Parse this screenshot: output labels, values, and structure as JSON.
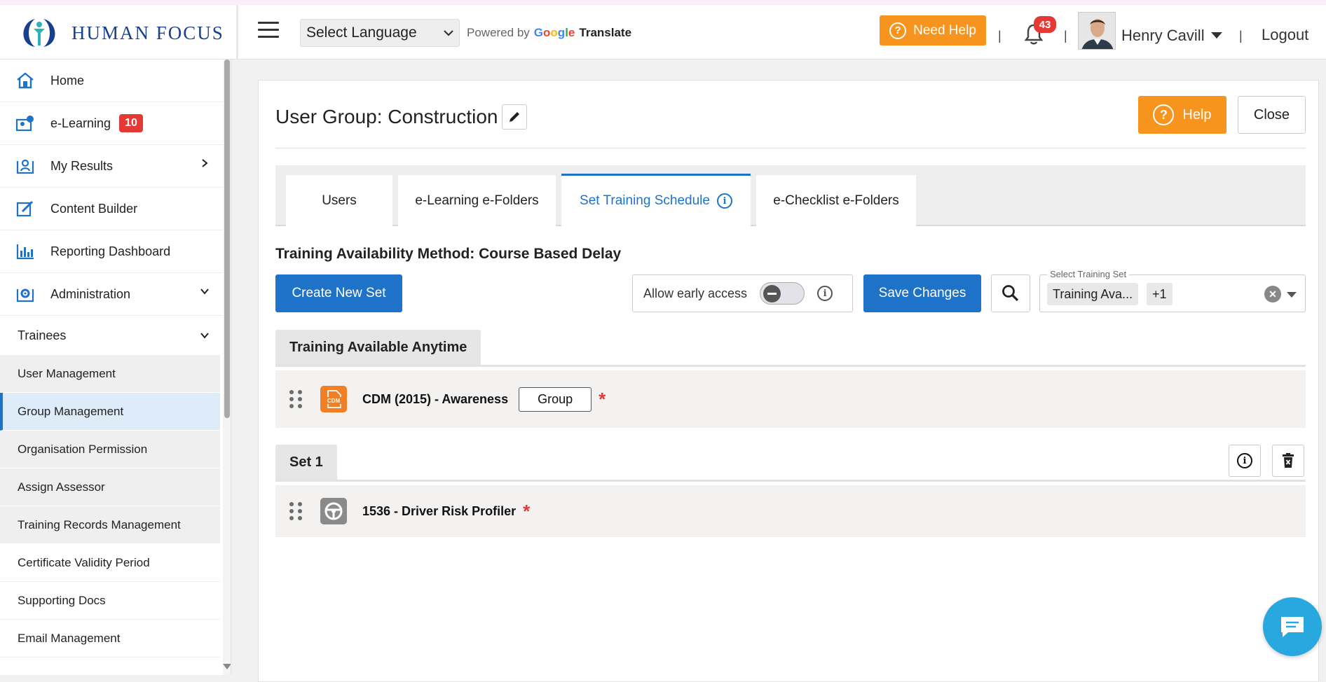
{
  "header": {
    "logo_text": "HUMAN FOCUS",
    "language_select": "Select Language",
    "powered_by": "Powered by",
    "google": "Google",
    "translate": "Translate",
    "need_help": "Need Help",
    "notifications_count": "43",
    "user_name": "Henry Cavill",
    "logout": "Logout"
  },
  "sidebar": {
    "items": [
      {
        "label": "Home",
        "icon": "home-icon"
      },
      {
        "label": "e-Learning",
        "icon": "elearning-icon",
        "badge": "10"
      },
      {
        "label": "My Results",
        "icon": "results-icon"
      },
      {
        "label": "Content Builder",
        "icon": "content-builder-icon"
      },
      {
        "label": "Reporting Dashboard",
        "icon": "reporting-icon"
      },
      {
        "label": "Administration",
        "icon": "admin-gear-icon"
      }
    ],
    "trainees_label": "Trainees",
    "trainees_items": [
      "User Management",
      "Group Management",
      "Organisation Permission",
      "Assign Assessor",
      "Training Records Management"
    ],
    "other_items": [
      "Certificate Validity Period",
      "Supporting Docs",
      "Email Management"
    ]
  },
  "page": {
    "title": "User Group: Construction",
    "help": "Help",
    "close": "Close",
    "tabs": [
      "Users",
      "e-Learning e-Folders",
      "Set Training Schedule",
      "e-Checklist e-Folders"
    ],
    "method": "Training Availability Method: Course Based Delay",
    "create_new_set": "Create New Set",
    "allow_early_access": "Allow early access",
    "save_changes": "Save Changes",
    "select_training_set_label": "Select Training Set",
    "selected_chip": "Training Ava...",
    "more_chip": "+1"
  },
  "sections": {
    "anytime_label": "Training Available Anytime",
    "anytime_course": "CDM (2015) - Awareness",
    "group_label": "Group",
    "cdm_icon_text": "CDM",
    "set1_label": "Set 1",
    "set1_course": "1536 - Driver Risk Profiler",
    "required_mark": "*"
  },
  "colors": {
    "accent_blue": "#1e73c9",
    "orange": "#f7941d",
    "badge_red": "#e53935",
    "chat_blue": "#29a8e0"
  }
}
